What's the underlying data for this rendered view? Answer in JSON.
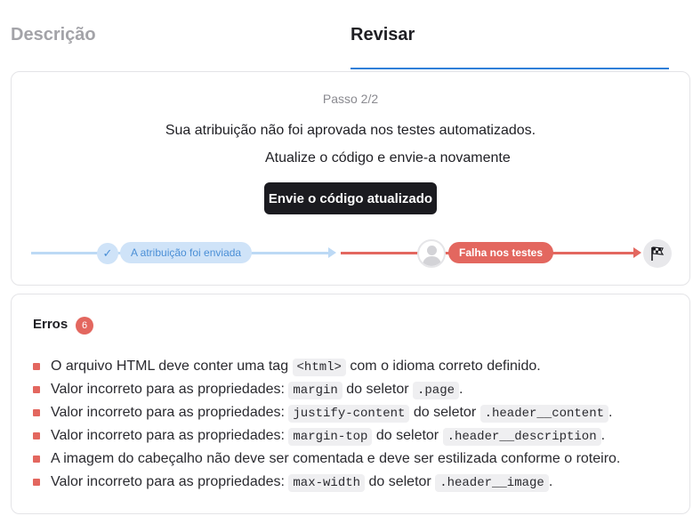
{
  "tabs": [
    {
      "label": "Descrição",
      "active": false
    },
    {
      "label": "Revisar",
      "active": true
    }
  ],
  "status": {
    "step": "Passo 2/2",
    "message_line1": "Sua atribuição não foi aprovada nos testes automatizados.",
    "message_line2": "Atualize o código e envie-a novamente",
    "submit_button": "Envie o código atualizado",
    "progress": {
      "submitted_label": "A atribuição foi enviada",
      "failed_label": "Falha nos testes",
      "icons": [
        "check-icon",
        "avatar-icon",
        "checkered-flag-icon"
      ]
    }
  },
  "errors": {
    "title": "Erros",
    "count": "6",
    "items": [
      {
        "t1": "O arquivo HTML deve conter uma tag ",
        "c1": "<html>",
        "t2": " com o idioma correto definido.",
        "c2": "",
        "t3": ""
      },
      {
        "t1": "Valor incorreto para as propriedades: ",
        "c1": "margin",
        "t2": " do seletor ",
        "c2": ".page",
        "t3": "."
      },
      {
        "t1": "Valor incorreto para as propriedades: ",
        "c1": "justify-content",
        "t2": " do seletor ",
        "c2": ".header__content",
        "t3": "."
      },
      {
        "t1": "Valor incorreto para as propriedades: ",
        "c1": "margin-top",
        "t2": " do seletor ",
        "c2": ".header__description",
        "t3": "."
      },
      {
        "t1": "A imagem do cabeçalho não deve ser comentada e deve ser estilizada conforme o roteiro.",
        "c1": "",
        "t2": "",
        "c2": "",
        "t3": ""
      },
      {
        "t1": "Valor incorreto para as propriedades: ",
        "c1": "max-width",
        "t2": " do seletor ",
        "c2": ".header__image",
        "t3": "."
      }
    ]
  },
  "colors": {
    "accent_blue": "#2f7fd8",
    "error_red": "#e3675f",
    "dark_button": "#1b1b20"
  }
}
